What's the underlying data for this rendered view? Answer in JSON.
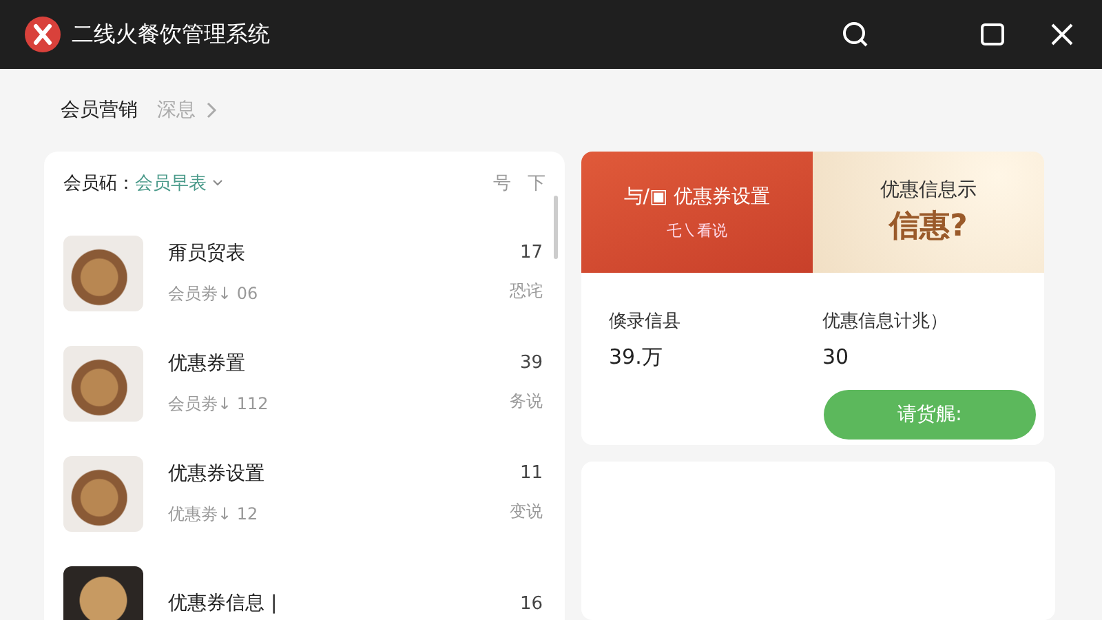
{
  "window": {
    "title": "二线火餐饮管理系统"
  },
  "breadcrumb": {
    "current": "会员营销",
    "next": "深息"
  },
  "list_panel": {
    "filter_label": "会员砳：",
    "filter_value": "会员早表",
    "actions": [
      "号",
      "下"
    ],
    "items": [
      {
        "title": "甭员贸表",
        "subtitle": "会员劵↓ 06",
        "count": "17",
        "status": "恐诧",
        "dark_photo": false
      },
      {
        "title": "优惠券置",
        "subtitle": "会员劵↓ 112",
        "count": "39",
        "status": "务说",
        "dark_photo": false
      },
      {
        "title": "优惠券设置",
        "subtitle": "优惠劵↓ 12",
        "count": "11",
        "status": "变说",
        "dark_photo": false
      },
      {
        "title": "优惠券信息 |",
        "count": "16",
        "dark_photo": true
      }
    ]
  },
  "banner": {
    "left_title": "与/▣ 优惠券设置",
    "left_sub": "乇㇏看说",
    "right_title": "优惠信息示",
    "right_big": "信惠?"
  },
  "info_card": {
    "stats": [
      {
        "label": "倏录信县",
        "value": "39.万"
      },
      {
        "label": "优惠信息计兆）",
        "value": "30"
      }
    ],
    "button": "请货艉:"
  }
}
